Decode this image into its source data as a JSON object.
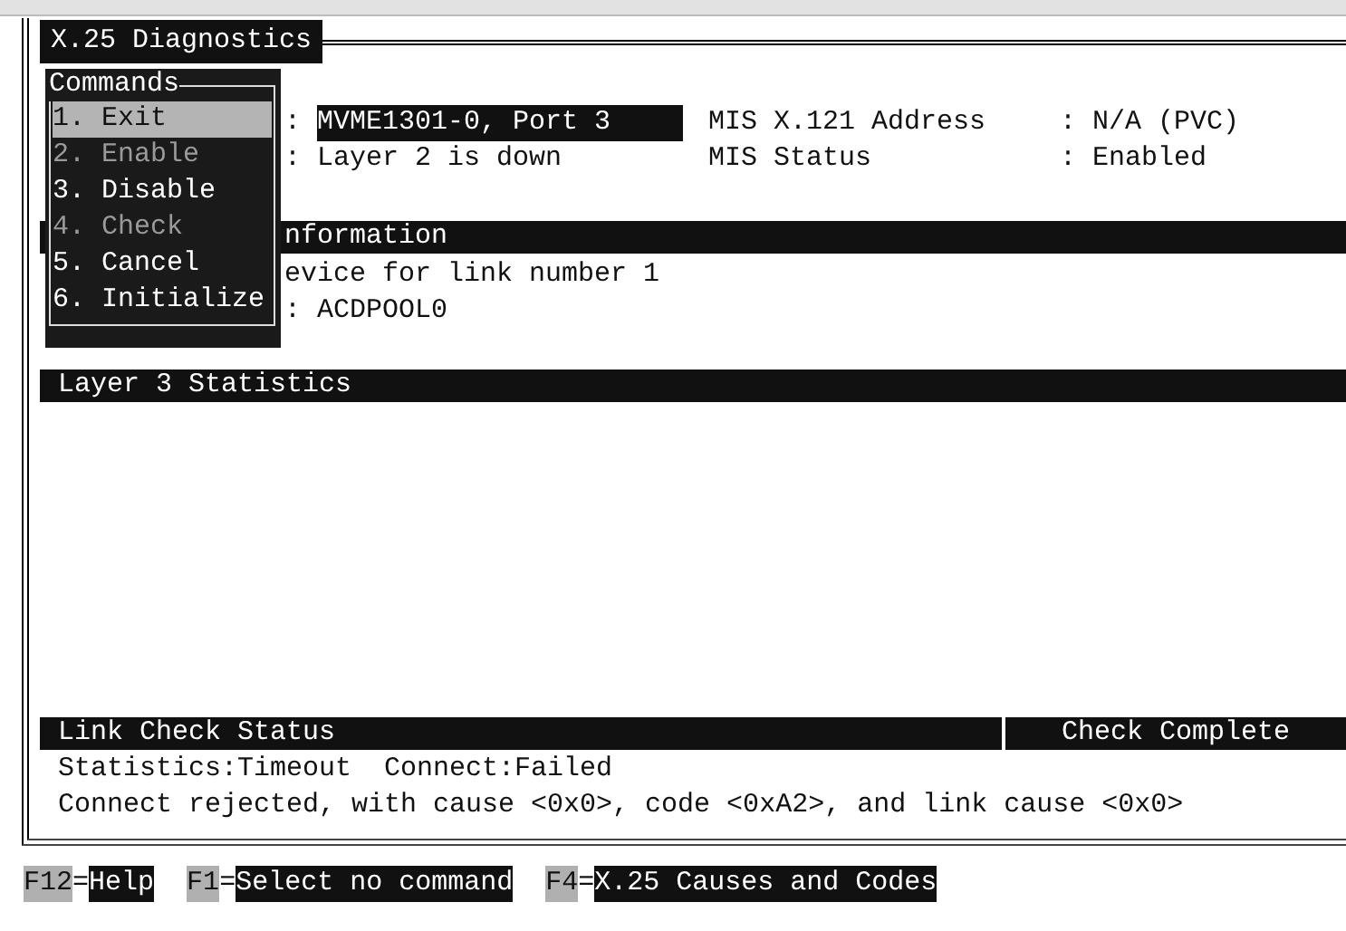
{
  "window": {
    "title": "X.25 Diagnostics"
  },
  "commands": {
    "title": "Commands",
    "items": [
      {
        "label": "1. Exit",
        "selected": true,
        "disabled": false
      },
      {
        "label": "2. Enable",
        "selected": false,
        "disabled": true
      },
      {
        "label": "3. Disable",
        "selected": false,
        "disabled": false
      },
      {
        "label": "4. Check",
        "selected": false,
        "disabled": true
      },
      {
        "label": "5. Cancel",
        "selected": false,
        "disabled": false
      },
      {
        "label": "6. Initialize",
        "selected": false,
        "disabled": false
      }
    ]
  },
  "info_rows": [
    {
      "separator": ":",
      "value": "MVME1301-0, Port 3",
      "highlighted": true,
      "label": "MIS X.121 Address",
      "label_value": ": N/A (PVC)"
    },
    {
      "separator": ":",
      "value": "Layer 2 is down",
      "highlighted": false,
      "label": "MIS Status",
      "label_value": ": Enabled"
    }
  ],
  "information": {
    "title": "nformation",
    "lines": [
      "evice for link number 1",
      ": ACDPOOL0"
    ]
  },
  "layer3": {
    "title": "Layer 3 Statistics"
  },
  "link_check": {
    "title": "Link Check Status",
    "result": "Check Complete",
    "lines": [
      "Statistics:Timeout  Connect:Failed",
      "Connect rejected, with cause <0x0>, code <0xA2>, and link cause <0x0>"
    ]
  },
  "key_hints": [
    {
      "key": "F12",
      "separator": "=",
      "action": "Help"
    },
    {
      "key": "F1",
      "separator": "=",
      "action": "Select no command"
    },
    {
      "key": "F4",
      "separator": "=",
      "action": "X.25 Causes and Codes"
    }
  ]
}
